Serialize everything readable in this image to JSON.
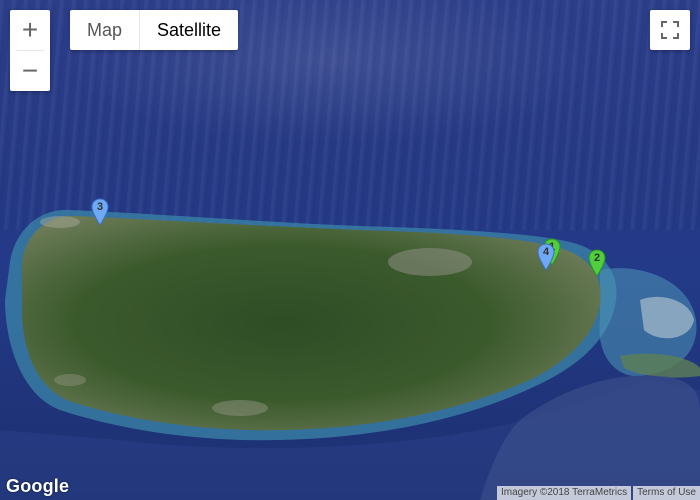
{
  "map": {
    "type_control": {
      "map_label": "Map",
      "satellite_label": "Satellite",
      "selected": "Satellite"
    },
    "zoom_in_label": "+",
    "zoom_out_label": "−",
    "logo_text": "Google",
    "attribution": {
      "imagery": "Imagery ©2018 TerraMetrics",
      "terms": "Terms of Use"
    },
    "markers": [
      {
        "label": "3",
        "color": "#6fa8f5"
      },
      {
        "label": "4",
        "color": "#6fa8f5"
      },
      {
        "label": "2",
        "color": "#4fcf3c"
      },
      {
        "label": "1",
        "color": "#4fcf3c"
      }
    ],
    "colors": {
      "ocean": "#233a88",
      "land": "#3b5a2c",
      "shallow": "#3f8fb0"
    }
  }
}
